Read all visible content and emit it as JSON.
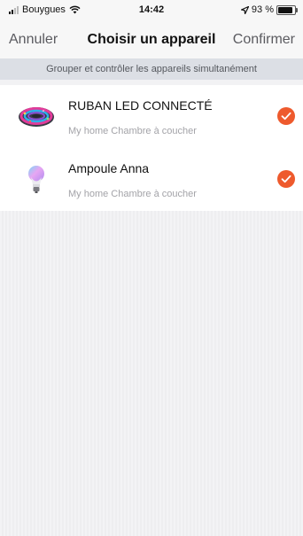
{
  "status_bar": {
    "carrier": "Bouygues",
    "time": "14:42",
    "battery": "93 %"
  },
  "nav": {
    "cancel_label": "Annuler",
    "title": "Choisir un appareil",
    "confirm_label": "Confirmer"
  },
  "banner_text": "Grouper et contrôler les appareils simultanément",
  "devices": [
    {
      "name": "RUBAN LED CONNECTÉ",
      "location": "My home Chambre à coucher",
      "selected": true,
      "icon": "led-strip-icon"
    },
    {
      "name": "Ampoule Anna",
      "location": "My home Chambre à coucher",
      "selected": true,
      "icon": "bulb-icon"
    }
  ],
  "colors": {
    "accent": "#ee5a2d",
    "banner": "#dcdfe5"
  }
}
